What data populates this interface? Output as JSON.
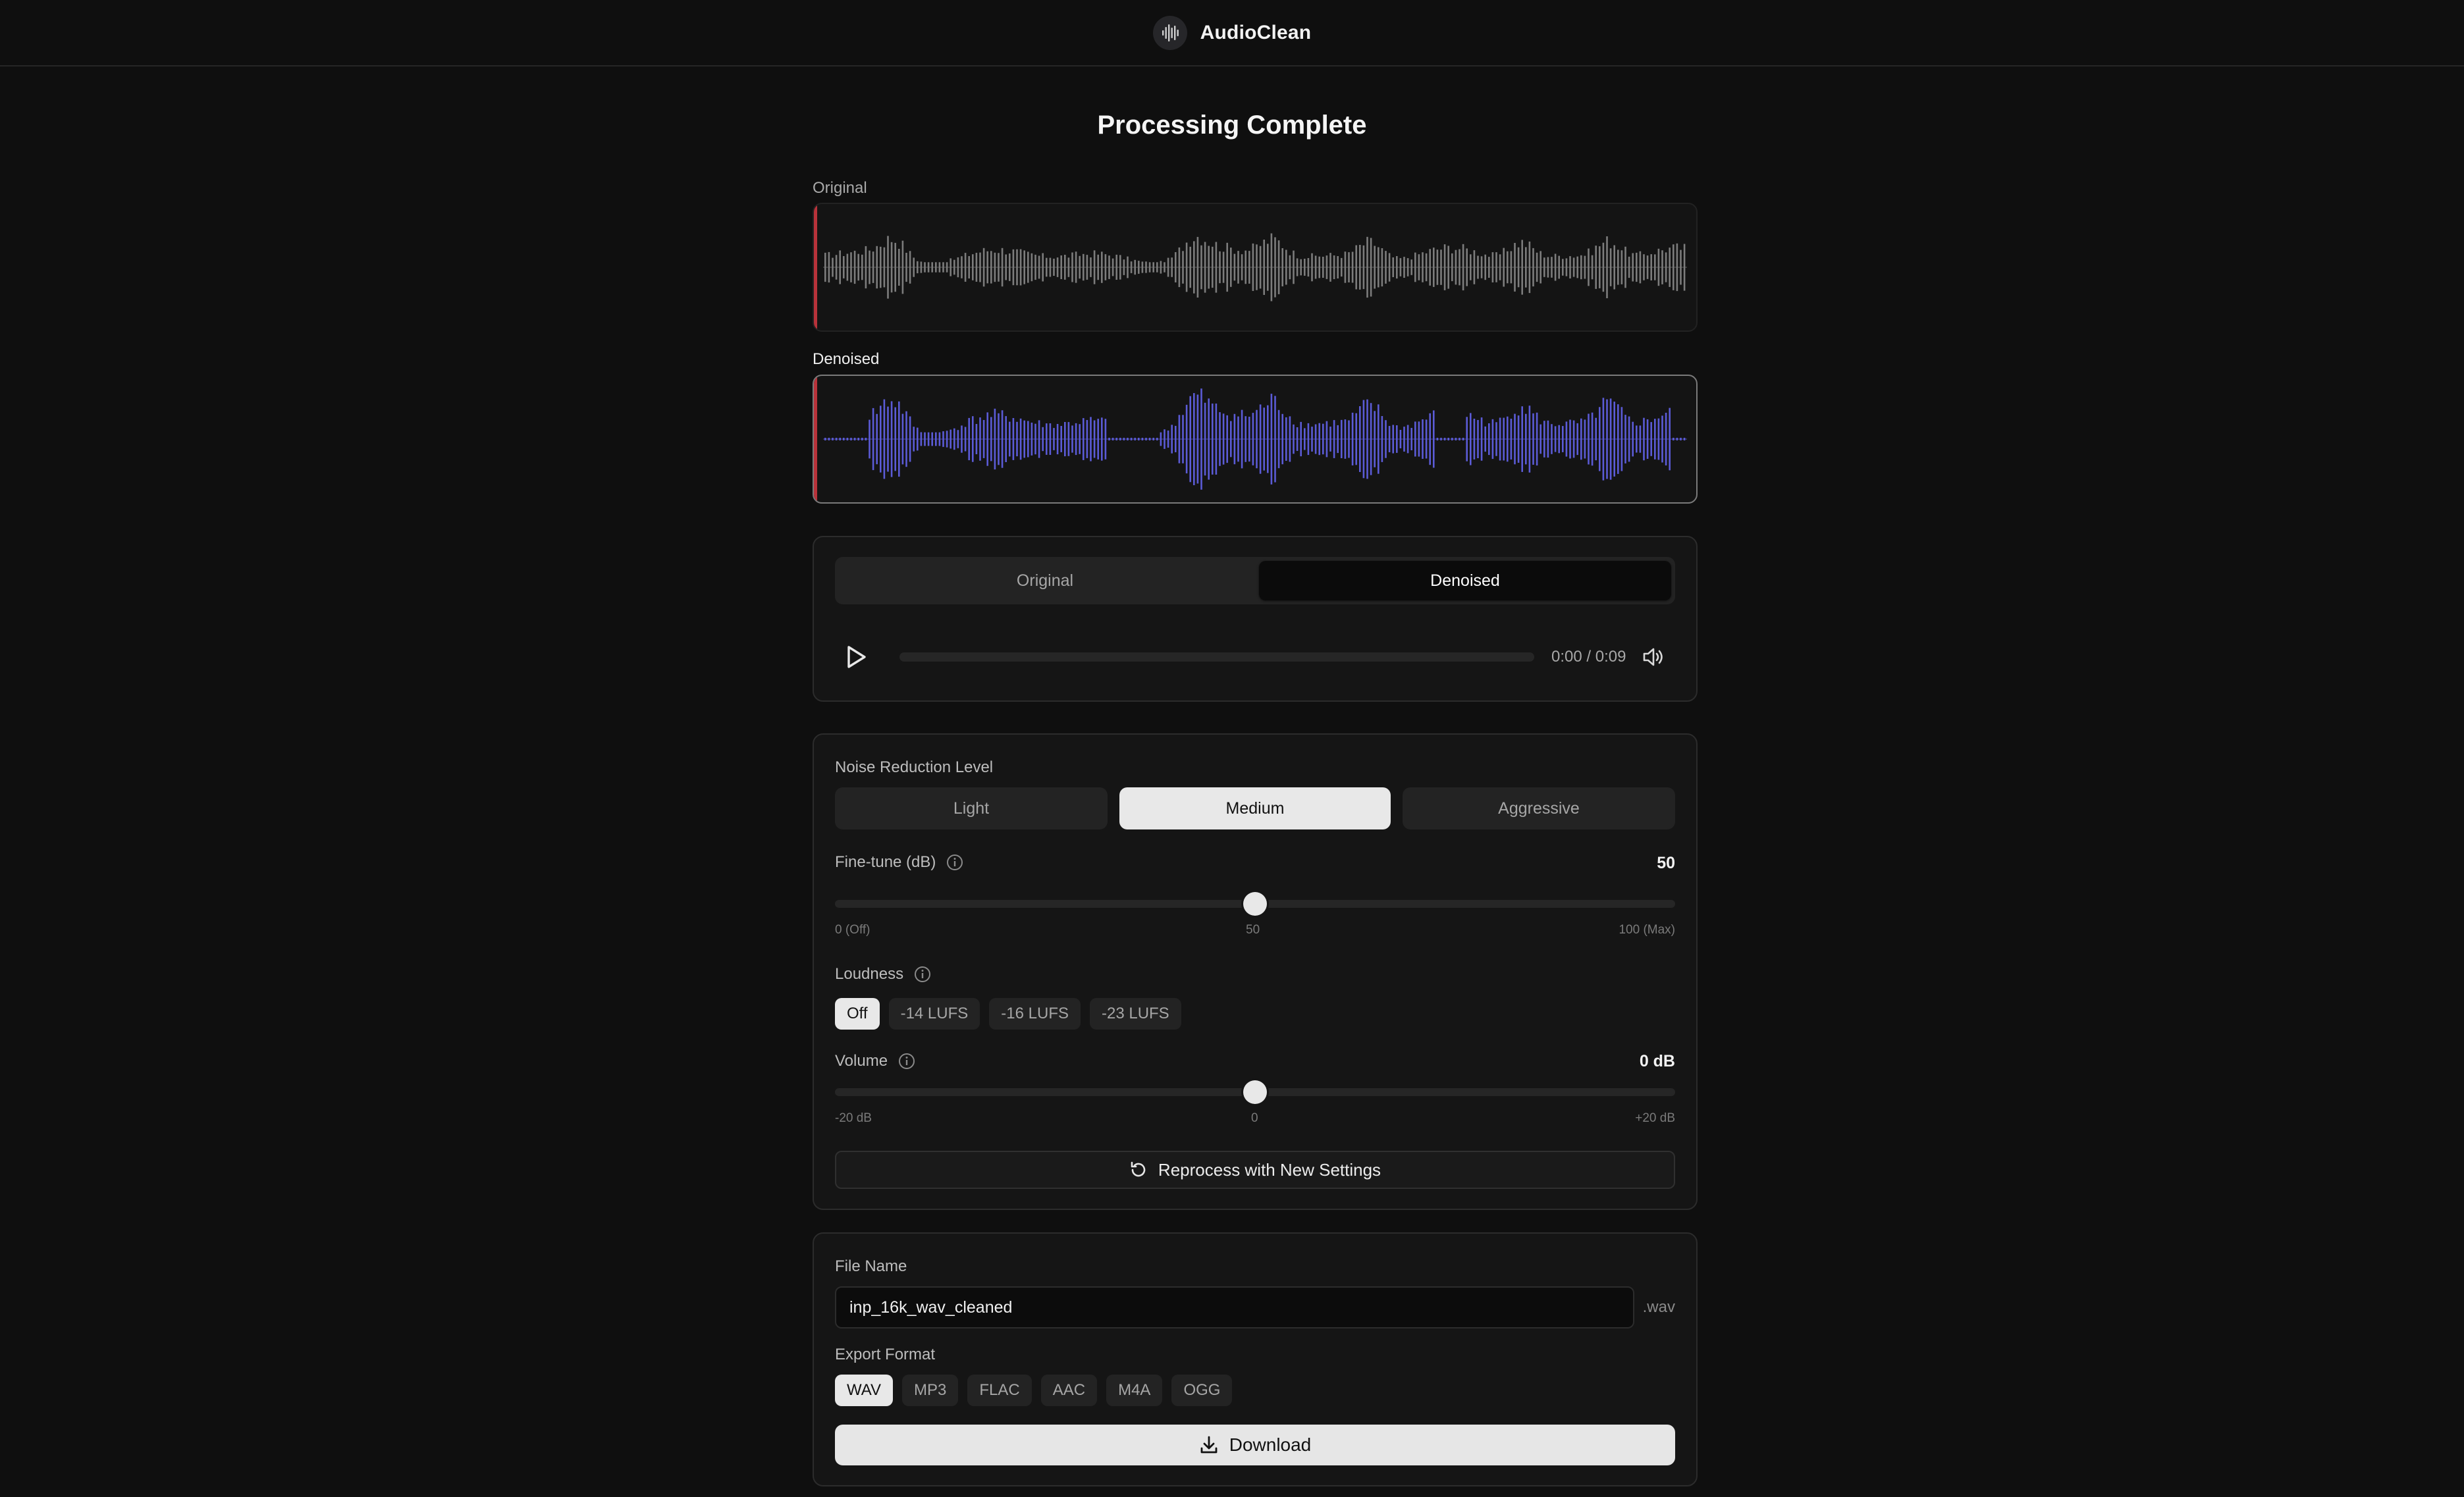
{
  "app": {
    "name": "AudioClean",
    "logo_icon": "waveform-icon"
  },
  "page": {
    "title": "Processing Complete"
  },
  "waveforms": {
    "original": {
      "label": "Original",
      "color": "#7c7c7c"
    },
    "denoised": {
      "label": "Denoised",
      "color": "#5b5bd6"
    },
    "playhead_color": "#b8323a"
  },
  "player": {
    "tabs": [
      {
        "label": "Original",
        "active": false
      },
      {
        "label": "Denoised",
        "active": true
      }
    ],
    "play_icon": "play-icon",
    "time": "0:00 / 0:09",
    "volume_icon": "speaker-icon",
    "progress": 0
  },
  "settings": {
    "noise_label": "Noise Reduction Level",
    "levels": [
      {
        "label": "Light",
        "active": false
      },
      {
        "label": "Medium",
        "active": true
      },
      {
        "label": "Aggressive",
        "active": false
      }
    ],
    "finetune": {
      "label": "Fine-tune (dB)",
      "value_text": "50",
      "value": 50,
      "min": 0,
      "max": 100,
      "tick_min": "0 (Off)",
      "tick_mid": "50",
      "tick_max": "100 (Max)"
    },
    "loudness": {
      "label": "Loudness",
      "options": [
        {
          "label": "Off",
          "active": true
        },
        {
          "label": "-14 LUFS",
          "active": false
        },
        {
          "label": "-16 LUFS",
          "active": false
        },
        {
          "label": "-23 LUFS",
          "active": false
        }
      ]
    },
    "volume": {
      "label": "Volume",
      "value_text": "0 dB",
      "value": 0,
      "min": -20,
      "max": 20,
      "tick_min": "-20 dB",
      "tick_mid": "0",
      "tick_max": "+20 dB"
    },
    "reprocess_label": "Reprocess with New Settings",
    "reprocess_icon": "refresh-icon",
    "info_icon": "info-icon"
  },
  "export": {
    "file_name_label": "File Name",
    "file_name_value": "inp_16k_wav_cleaned",
    "extension": ".wav",
    "format_label": "Export Format",
    "formats": [
      {
        "label": "WAV",
        "active": true
      },
      {
        "label": "MP3",
        "active": false
      },
      {
        "label": "FLAC",
        "active": false
      },
      {
        "label": "AAC",
        "active": false
      },
      {
        "label": "M4A",
        "active": false
      },
      {
        "label": "OGG",
        "active": false
      }
    ],
    "download_label": "Download",
    "download_icon": "download-icon"
  }
}
